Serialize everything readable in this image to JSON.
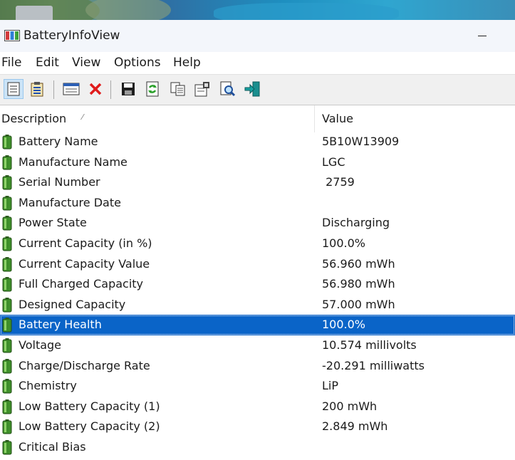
{
  "window": {
    "title": "BatteryInfoView"
  },
  "menu": [
    "File",
    "Edit",
    "View",
    "Options",
    "Help"
  ],
  "toolbar": {
    "buttons": [
      "html-report-icon",
      "properties-icon",
      "options-icon",
      "delete-icon",
      "save-icon",
      "refresh-icon",
      "copy-icon",
      "properties-page-icon",
      "find-icon",
      "exit-icon"
    ]
  },
  "columns": {
    "description": "Description",
    "value": "Value"
  },
  "rows": [
    {
      "description": "Battery Name",
      "value": "5B10W13909"
    },
    {
      "description": "Manufacture Name",
      "value": "LGC"
    },
    {
      "description": "Serial Number",
      "value": " 2759"
    },
    {
      "description": "Manufacture Date",
      "value": ""
    },
    {
      "description": "Power State",
      "value": "Discharging"
    },
    {
      "description": "Current Capacity (in %)",
      "value": "100.0%"
    },
    {
      "description": "Current Capacity Value",
      "value": "56.960 mWh"
    },
    {
      "description": "Full Charged Capacity",
      "value": "56.980 mWh"
    },
    {
      "description": "Designed Capacity",
      "value": "57.000 mWh"
    },
    {
      "description": "Battery Health",
      "value": "100.0%",
      "selected": true
    },
    {
      "description": "Voltage",
      "value": "10.574 millivolts"
    },
    {
      "description": "Charge/Discharge Rate",
      "value": "-20.291 milliwatts"
    },
    {
      "description": "Chemistry",
      "value": "LiP"
    },
    {
      "description": "Low Battery Capacity (1)",
      "value": "200 mWh"
    },
    {
      "description": "Low Battery Capacity (2)",
      "value": "2.849 mWh"
    },
    {
      "description": "Critical Bias",
      "value": ""
    }
  ],
  "colors": {
    "selection": "#0a64c8",
    "battery_green": "#3f8f2a"
  }
}
